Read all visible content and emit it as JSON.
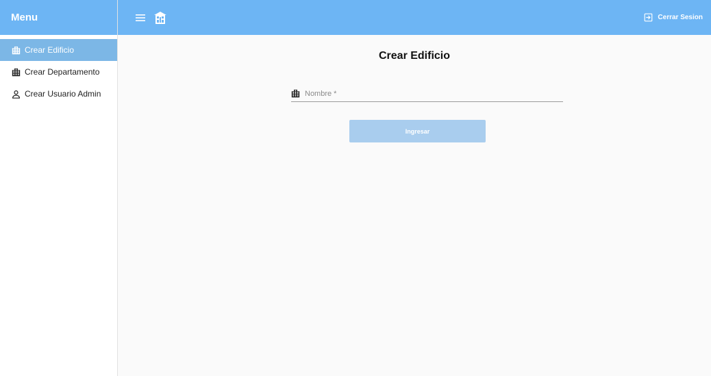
{
  "colors": {
    "primary": "#6db5f4",
    "active_item": "#7cb7e6",
    "button_disabled": "#a9cdee"
  },
  "sidebar": {
    "title": "Menu",
    "items": [
      {
        "label": "Crear Edificio",
        "icon": "building-icon",
        "active": true
      },
      {
        "label": "Crear Departamento",
        "icon": "building-icon",
        "active": false
      },
      {
        "label": "Crear Usuario Admin",
        "icon": "user-icon",
        "active": false
      }
    ]
  },
  "topbar": {
    "menu_icon": "hamburger-icon",
    "brand_icon": "building-icon",
    "logout_label": "Cerrar Sesion",
    "logout_icon": "logout-icon"
  },
  "main": {
    "title": "Crear Edificio",
    "nombre_field": {
      "placeholder": "Nombre *",
      "value": "",
      "icon": "building-icon"
    },
    "submit_label": "Ingresar"
  }
}
